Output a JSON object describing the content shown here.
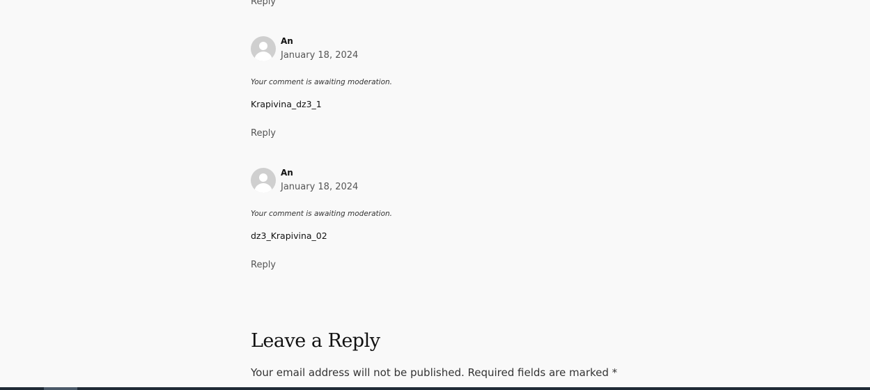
{
  "top_reply": {
    "label": "Reply"
  },
  "comments": [
    {
      "author": "An",
      "date": "January 18, 2024",
      "moderation": "Your comment is awaiting moderation.",
      "text": "Krapivina_dz3_1",
      "reply_label": "Reply"
    },
    {
      "author": "An",
      "date": "January 18, 2024",
      "moderation": "Your comment is awaiting moderation.",
      "text": "dz3_Krapivina_02",
      "reply_label": "Reply"
    }
  ],
  "respond": {
    "title": "Leave a Reply",
    "notes": "Your email address will not be published. Required fields are marked *"
  },
  "colors": {
    "background": "#f9f9f9",
    "text": "#111111",
    "muted": "#555555",
    "avatar": "#cfcfcf",
    "bottom_bar": "#1f2a36"
  }
}
